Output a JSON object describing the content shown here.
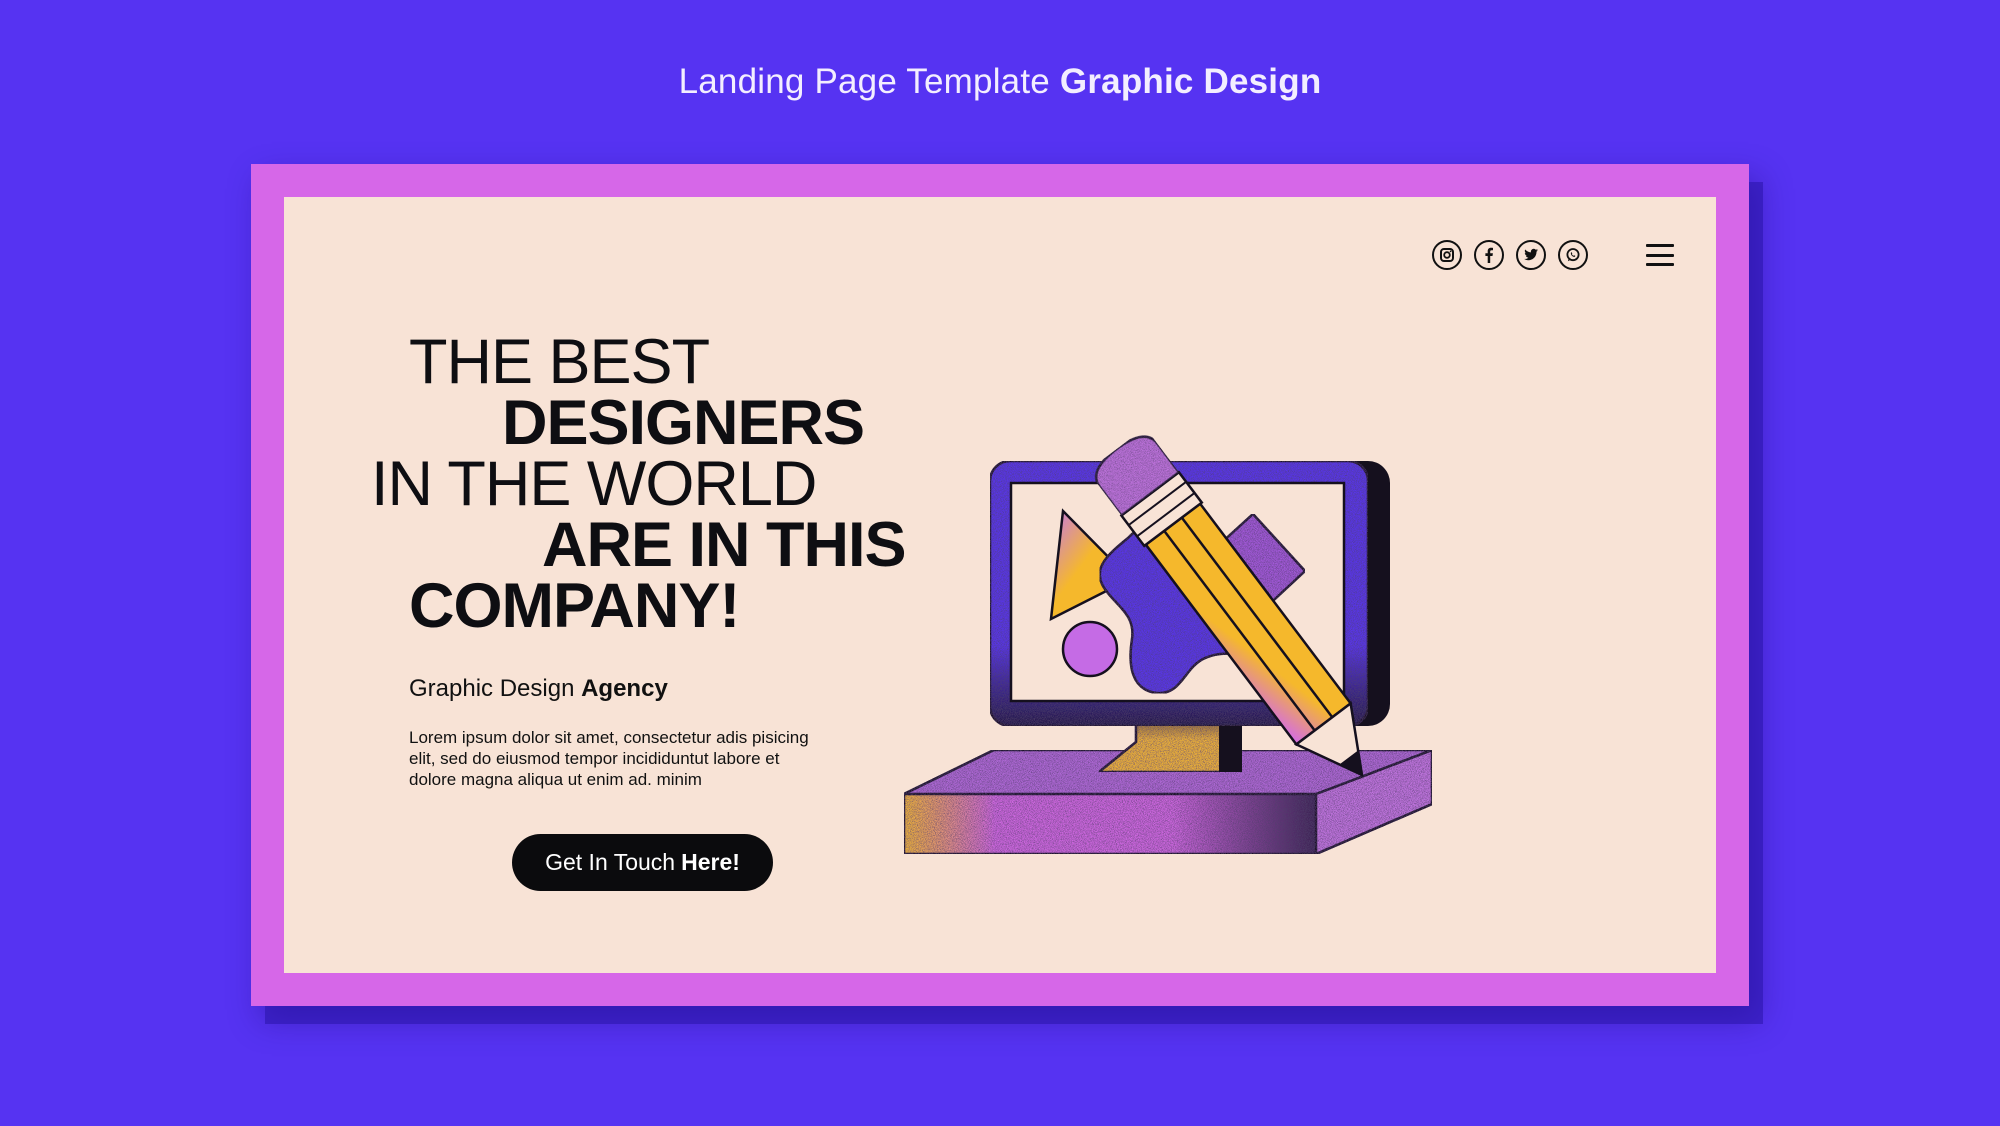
{
  "caption": {
    "light": "Landing Page Template",
    "bold": "Graphic Design"
  },
  "social_icons": [
    "instagram-icon",
    "facebook-icon",
    "twitter-icon",
    "whatsapp-icon"
  ],
  "menu_icon": "hamburger-menu-icon",
  "hero": {
    "headline": {
      "line1": "THE BEST",
      "line2": "DESIGNERS",
      "line3": "IN THE WORLD",
      "line4": "ARE IN THIS",
      "line5": "COMPANY!"
    },
    "subtitle_regular": "Graphic Design",
    "subtitle_bold": "Agency",
    "body": "Lorem ipsum dolor sit amet, consectetur adis pisicing elit, sed do eiusmod tempor incididuntut labore et dolore magna aliqua ut enim ad. minim",
    "cta_regular": "Get In Touch",
    "cta_bold": "Here!"
  },
  "colors": {
    "background": "#5633F2",
    "frame": "#D667E8",
    "page": "#F8E3D6",
    "ink": "#0E0E12",
    "yellow": "#F5B82C",
    "purple": "#C778E6",
    "blue": "#5A34F0"
  }
}
